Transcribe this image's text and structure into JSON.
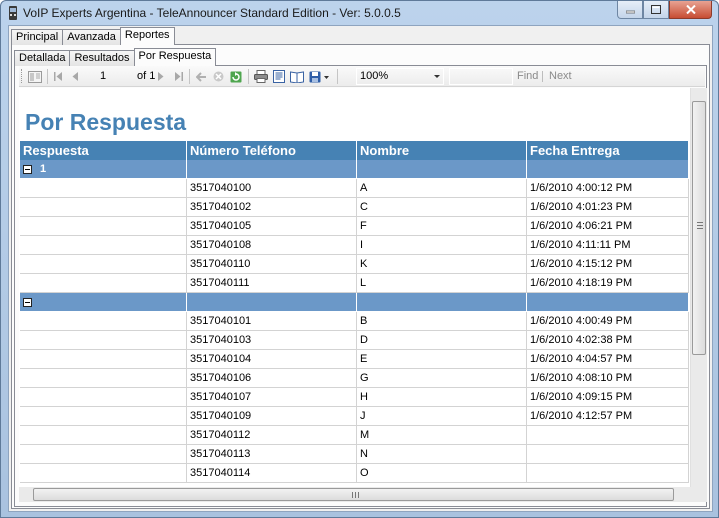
{
  "window": {
    "title": "VoIP Experts Argentina - TeleAnnouncer  Standard Edition - Ver: 5.0.0.5"
  },
  "outer_tabs": [
    {
      "label": "Principal"
    },
    {
      "label": "Avanzada"
    },
    {
      "label": "Reportes"
    }
  ],
  "inner_tabs": [
    {
      "label": "Detallada"
    },
    {
      "label": "Resultados"
    },
    {
      "label": "Por Respuesta"
    }
  ],
  "toolbar": {
    "page_value": "1",
    "page_of": "of 1",
    "zoom": "100%",
    "find_label": "Find",
    "next_label": "Next"
  },
  "report": {
    "title": "Por Respuesta",
    "columns": [
      "Respuesta",
      "Número Teléfono",
      "Nombre",
      "Fecha Entrega"
    ],
    "groups": [
      {
        "label": "1",
        "rows": [
          {
            "telefono": "3517040100",
            "nombre": "A",
            "fecha": "1/6/2010 4:00:12 PM"
          },
          {
            "telefono": "3517040102",
            "nombre": "C",
            "fecha": "1/6/2010 4:01:23 PM"
          },
          {
            "telefono": "3517040105",
            "nombre": "F",
            "fecha": "1/6/2010 4:06:21 PM"
          },
          {
            "telefono": "3517040108",
            "nombre": "I",
            "fecha": "1/6/2010 4:11:11 PM"
          },
          {
            "telefono": "3517040110",
            "nombre": "K",
            "fecha": "1/6/2010 4:15:12 PM"
          },
          {
            "telefono": "3517040111",
            "nombre": "L",
            "fecha": "1/6/2010 4:18:19 PM"
          }
        ]
      },
      {
        "label": "",
        "rows": [
          {
            "telefono": "3517040101",
            "nombre": "B",
            "fecha": "1/6/2010 4:00:49 PM"
          },
          {
            "telefono": "3517040103",
            "nombre": "D",
            "fecha": "1/6/2010 4:02:38 PM"
          },
          {
            "telefono": "3517040104",
            "nombre": "E",
            "fecha": "1/6/2010 4:04:57 PM"
          },
          {
            "telefono": "3517040106",
            "nombre": "G",
            "fecha": "1/6/2010 4:08:10 PM"
          },
          {
            "telefono": "3517040107",
            "nombre": "H",
            "fecha": "1/6/2010 4:09:15 PM"
          },
          {
            "telefono": "3517040109",
            "nombre": "J",
            "fecha": "1/6/2010 4:12:57 PM"
          },
          {
            "telefono": "3517040112",
            "nombre": "M",
            "fecha": ""
          },
          {
            "telefono": "3517040113",
            "nombre": "N",
            "fecha": ""
          },
          {
            "telefono": "3517040114",
            "nombre": "O",
            "fecha": ""
          }
        ]
      }
    ]
  },
  "colors": {
    "header_bg": "#4682b4",
    "group_bg": "#6b98c8",
    "title": "#4682b4"
  }
}
